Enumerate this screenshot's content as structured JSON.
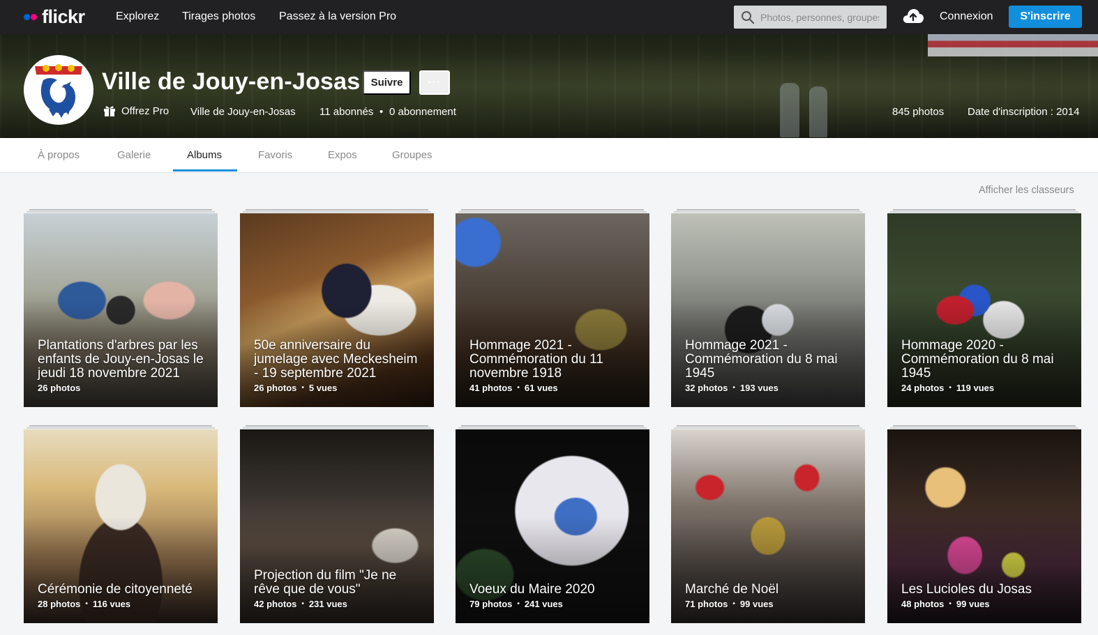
{
  "topnav": {
    "logo_text": "flickr",
    "links": [
      "Explorez",
      "Tirages photos",
      "Passez à la version Pro"
    ],
    "search_placeholder": "Photos, personnes, groupes",
    "login": "Connexion",
    "signup": "S'inscrire"
  },
  "profile": {
    "name": "Ville de Jouy-en-Josas",
    "follow": "Suivre",
    "more": "···",
    "offer_pro": "Offrez Pro",
    "display_name": "Ville de Jouy-en-Josas",
    "followers": "11 abonnés",
    "following": "0 abonnement",
    "photo_count": "845 photos",
    "joined": "Date d'inscription : 2014"
  },
  "tabs": [
    "À propos",
    "Galerie",
    "Albums",
    "Favoris",
    "Expos",
    "Groupes"
  ],
  "active_tab": "Albums",
  "show_collections": "Afficher les classeurs",
  "albums": [
    {
      "title": "Plantations d'arbres par les enfants de Jouy-en-Josas le jeudi 18 novembre 2021",
      "photos": "26 photos",
      "views": ""
    },
    {
      "title": "50e anniversaire du jumelage avec Meckesheim - 19 septembre 2021",
      "photos": "26 photos",
      "views": "5 vues"
    },
    {
      "title": "Hommage 2021 - Commémoration du 11 novembre 1918",
      "photos": "41 photos",
      "views": "61 vues"
    },
    {
      "title": "Hommage 2021 - Commémoration du 8 mai 1945",
      "photos": "32 photos",
      "views": "193 vues"
    },
    {
      "title": "Hommage 2020 - Commémoration du 8 mai 1945",
      "photos": "24 photos",
      "views": "119 vues"
    },
    {
      "title": "Cérémonie de citoyenneté",
      "photos": "28 photos",
      "views": "116 vues"
    },
    {
      "title": "Projection du film \"Je ne rêve que de vous\"",
      "photos": "42 photos",
      "views": "231 vues"
    },
    {
      "title": "Voeux du Maire 2020",
      "photos": "79 photos",
      "views": "241 vues"
    },
    {
      "title": "Marché de Noël",
      "photos": "71 photos",
      "views": "99 vues"
    },
    {
      "title": "Les Lucioles du Josas",
      "photos": "48 photos",
      "views": "99 vues"
    }
  ],
  "colors": {
    "topbar": "#212124",
    "signup": "#128fdc",
    "active_underline": "#128fdc",
    "logo_blue": "#0063dc",
    "logo_pink": "#ff0084"
  }
}
